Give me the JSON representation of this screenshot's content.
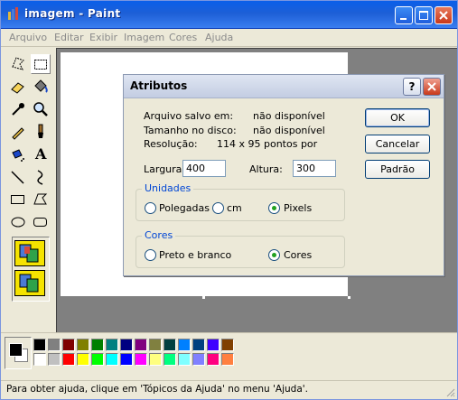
{
  "window": {
    "title": "imagem - Paint"
  },
  "menu": [
    "Arquivo",
    "Editar",
    "Exibir",
    "Imagem",
    "Cores",
    "Ajuda"
  ],
  "tools": [
    "free-select",
    "rect-select",
    "eraser",
    "fill",
    "color-picker",
    "magnifier",
    "pencil",
    "brush",
    "airbrush",
    "text",
    "line",
    "curve",
    "rectangle",
    "polygon",
    "ellipse",
    "rounded-rectangle"
  ],
  "text_tool_glyph": "A",
  "palette": {
    "top": [
      "#000000",
      "#808080",
      "#800000",
      "#808000",
      "#008000",
      "#008080",
      "#000080",
      "#800080",
      "#808040",
      "#004040",
      "#0080ff",
      "#004080",
      "#4000ff",
      "#804000"
    ],
    "bottom": [
      "#ffffff",
      "#c0c0c0",
      "#ff0000",
      "#ffff00",
      "#00ff00",
      "#00ffff",
      "#0000ff",
      "#ff00ff",
      "#ffff80",
      "#00ff80",
      "#80ffff",
      "#8080ff",
      "#ff0080",
      "#ff8040"
    ]
  },
  "status": "Para obter ajuda, clique em 'Tópicos da Ajuda' no menu 'Ajuda'.",
  "dialog": {
    "title": "Atributos",
    "help_btn": "?",
    "info": {
      "saved_label": "Arquivo salvo em:",
      "saved_value": "não disponível",
      "size_label": "Tamanho no disco:",
      "size_value": "não disponível",
      "resolution_label": "Resolução:",
      "resolution_value": "114 x 95 pontos por"
    },
    "width_label": "Largura:",
    "width_value": "400",
    "height_label": "Altura:",
    "height_value": "300",
    "units": {
      "label": "Unidades",
      "options": [
        "Polegadas",
        "cm",
        "Pixels"
      ],
      "selected": "Pixels"
    },
    "colors": {
      "label": "Cores",
      "options": [
        "Preto e branco",
        "Cores"
      ],
      "selected": "Cores"
    },
    "buttons": {
      "ok": "OK",
      "cancel": "Cancelar",
      "default": "Padrão"
    }
  }
}
